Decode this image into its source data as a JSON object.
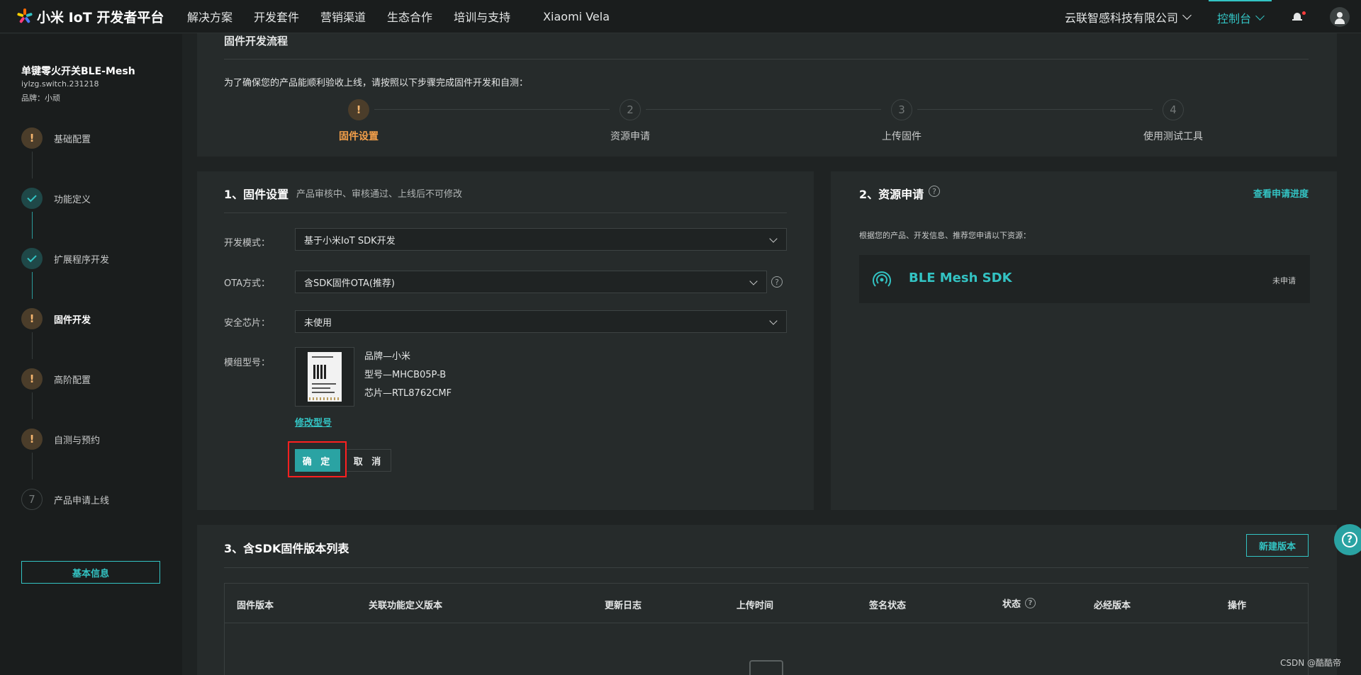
{
  "colors": {
    "accent": "#33c3c3",
    "warning": "#f5a04a",
    "highlight_box": "#ff2020",
    "notification_dot": "#ff3b3b"
  },
  "topnav": {
    "brand": "小米 IoT 开发者平台",
    "items": [
      "解决方案",
      "开发套件",
      "营销渠道",
      "生态合作",
      "培训与支持",
      "Xiaomi Vela"
    ],
    "company": "云联智感科技有限公司",
    "console": "控制台",
    "icons": [
      "logo-icon",
      "chevron-down-icon",
      "bell-icon",
      "user-avatar-icon"
    ]
  },
  "sidebar": {
    "product_name": "单键零火开关BLE-Mesh",
    "product_id": "iylzg.switch.231218",
    "product_brand": "品牌：小顽",
    "steps": [
      {
        "label": "基础配置",
        "state": "warning",
        "icon": "!"
      },
      {
        "label": "功能定义",
        "state": "done",
        "icon": "check"
      },
      {
        "label": "扩展程序开发",
        "state": "done",
        "icon": "check"
      },
      {
        "label": "固件开发",
        "state": "warning-active",
        "icon": "!"
      },
      {
        "label": "高阶配置",
        "state": "warning",
        "icon": "!"
      },
      {
        "label": "自测与预约",
        "state": "warning",
        "icon": "!"
      },
      {
        "label": "产品申请上线",
        "state": "pending",
        "icon": "7"
      }
    ],
    "basic_info_button": "基本信息"
  },
  "flow": {
    "title": "固件开发流程",
    "description": "为了确保您的产品能顺利验收上线，请按照以下步骤完成固件开发和自测：",
    "steps": [
      {
        "marker": "!",
        "label": "固件设置",
        "active": true
      },
      {
        "marker": "2",
        "label": "资源申请",
        "active": false
      },
      {
        "marker": "3",
        "label": "上传固件",
        "active": false
      },
      {
        "marker": "4",
        "label": "使用测试工具",
        "active": false
      }
    ]
  },
  "firmware_settings": {
    "title": "1、固件设置",
    "note": "产品审核中、审核通过、上线后不可修改",
    "dev_mode_label": "开发模式：",
    "dev_mode_value": "基于小米IoT SDK开发",
    "ota_label": "OTA方式：",
    "ota_value": "含SDK固件OTA(推荐)",
    "chip_label": "安全芯片：",
    "chip_value": "未使用",
    "module_label": "模组型号：",
    "module_brand": "品牌—小米",
    "module_model": "型号—MHCB05P-B",
    "module_chip": "芯片—RTL8762CMF",
    "modify_link": "修改型号",
    "confirm_button": "确 定",
    "cancel_button": "取 消"
  },
  "resources": {
    "title": "2、资源申请",
    "progress_link": "查看申请进度",
    "description": "根据您的产品、开发信息、推荐您申请以下资源：",
    "card_title": "BLE Mesh SDK",
    "card_status": "未申请"
  },
  "version_list": {
    "title": "3、含SDK固件版本列表",
    "new_version_button": "新建版本",
    "columns": [
      "固件版本",
      "关联功能定义版本",
      "更新日志",
      "上传时间",
      "签名状态",
      "状态",
      "必经版本",
      "操作"
    ]
  },
  "watermark": "CSDN @酷酷帝"
}
